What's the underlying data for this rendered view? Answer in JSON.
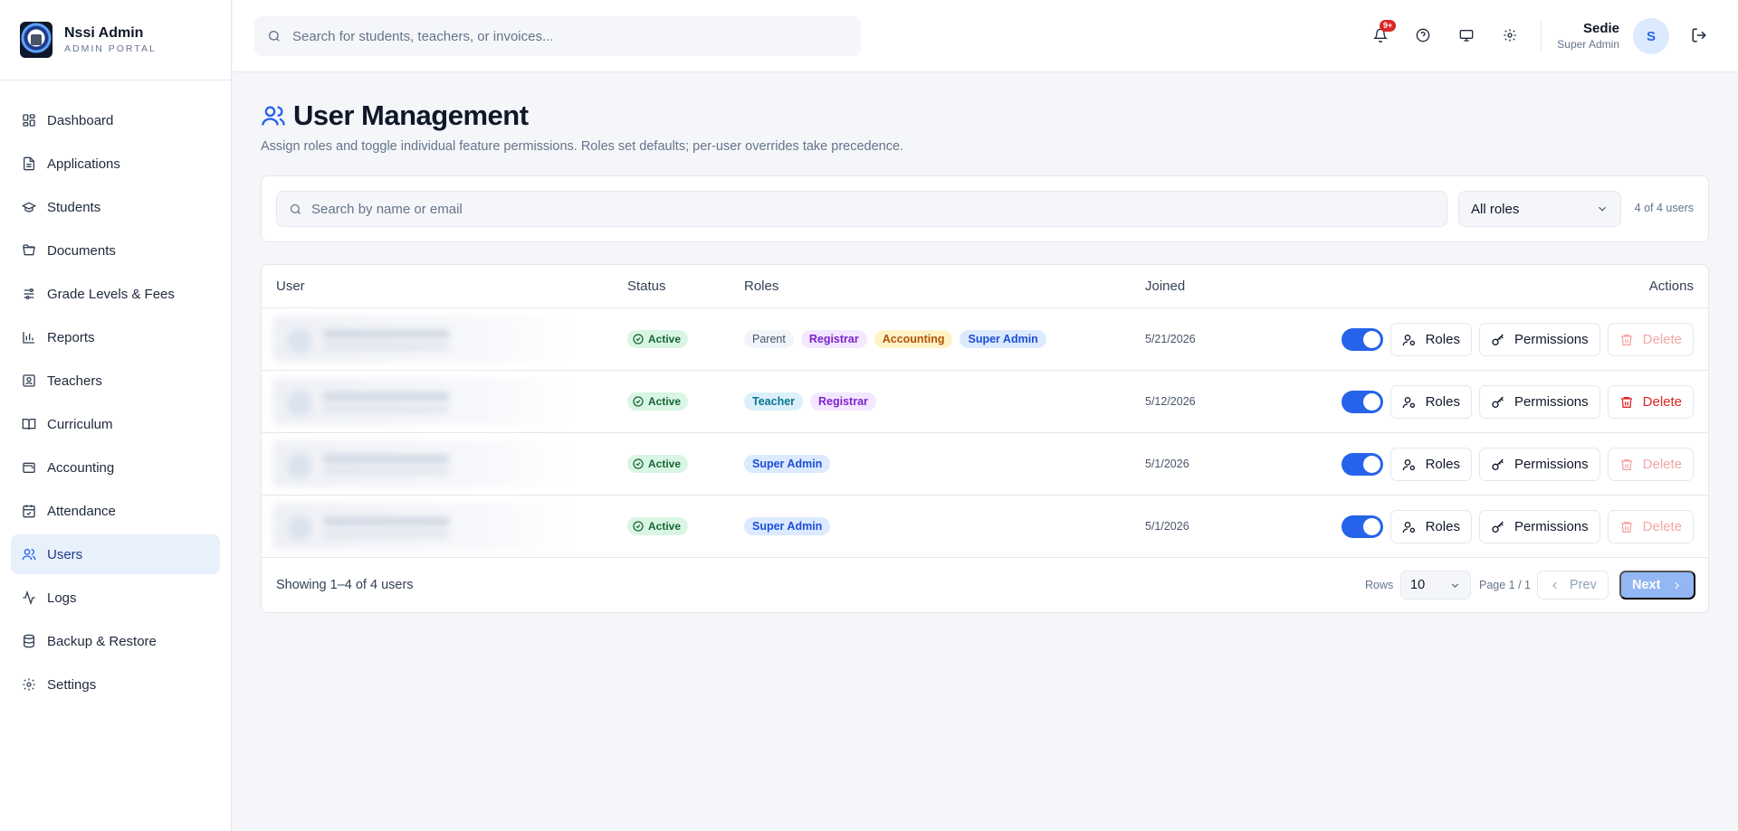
{
  "brand": {
    "name": "Nssi Admin",
    "subtitle": "ADMIN PORTAL"
  },
  "sidebar": {
    "items": [
      {
        "label": "Dashboard",
        "icon": "dashboard-icon"
      },
      {
        "label": "Applications",
        "icon": "file-text-icon"
      },
      {
        "label": "Students",
        "icon": "graduation-cap-icon"
      },
      {
        "label": "Documents",
        "icon": "folder-open-icon"
      },
      {
        "label": "Grade Levels & Fees",
        "icon": "sliders-icon"
      },
      {
        "label": "Reports",
        "icon": "bar-chart-icon"
      },
      {
        "label": "Teachers",
        "icon": "id-card-icon"
      },
      {
        "label": "Curriculum",
        "icon": "book-open-icon"
      },
      {
        "label": "Accounting",
        "icon": "wallet-icon"
      },
      {
        "label": "Attendance",
        "icon": "calendar-check-icon"
      },
      {
        "label": "Users",
        "icon": "users-icon",
        "active": true
      },
      {
        "label": "Logs",
        "icon": "activity-icon"
      },
      {
        "label": "Backup & Restore",
        "icon": "database-icon"
      },
      {
        "label": "Settings",
        "icon": "gear-icon"
      }
    ]
  },
  "topbar": {
    "search_placeholder": "Search for students, teachers, or invoices...",
    "notification_badge": "9+",
    "user": {
      "name": "Sedie",
      "role": "Super Admin",
      "initial": "S"
    }
  },
  "page": {
    "title": "User Management",
    "description": "Assign roles and toggle individual feature permissions. Roles set defaults; per-user overrides take precedence."
  },
  "filters": {
    "search_placeholder": "Search by name or email",
    "role_select": "All roles",
    "count": "4 of 4 users"
  },
  "table": {
    "headers": {
      "user": "User",
      "status": "Status",
      "roles": "Roles",
      "joined": "Joined",
      "actions": "Actions"
    },
    "rows": [
      {
        "status": "Active",
        "roles": [
          "Parent",
          "Registrar",
          "Accounting",
          "Super Admin"
        ],
        "joined": "5/21/2026",
        "enabled": true,
        "delete_disabled": true
      },
      {
        "status": "Active",
        "roles": [
          "Teacher",
          "Registrar"
        ],
        "joined": "5/12/2026",
        "enabled": true,
        "delete_disabled": false
      },
      {
        "status": "Active",
        "roles": [
          "Super Admin"
        ],
        "joined": "5/1/2026",
        "enabled": true,
        "delete_disabled": true
      },
      {
        "status": "Active",
        "roles": [
          "Super Admin"
        ],
        "joined": "5/1/2026",
        "enabled": true,
        "delete_disabled": true
      }
    ],
    "buttons": {
      "roles": "Roles",
      "permissions": "Permissions",
      "delete": "Delete"
    }
  },
  "footer": {
    "showing": "Showing 1–4 of 4 users",
    "rows_label": "Rows",
    "rows_value": "10",
    "page_info": "Page 1 / 1",
    "prev": "Prev",
    "next": "Next"
  },
  "colors": {
    "accent": "#2563eb",
    "danger": "#dc2626",
    "success": "#166534"
  }
}
